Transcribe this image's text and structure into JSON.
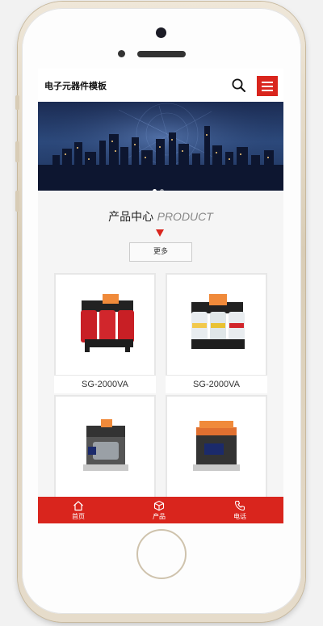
{
  "header": {
    "site_title": "电子元器件模板"
  },
  "section": {
    "title_cn": "产品中心",
    "title_en": "PRODUCT",
    "more_label": "更多"
  },
  "products": [
    {
      "name": "SG-2000VA"
    },
    {
      "name": "SG-2000VA"
    },
    {
      "name": ""
    },
    {
      "name": ""
    }
  ],
  "tabbar": {
    "home_label": "首页",
    "products_label": "产品",
    "phone_label": "电话"
  },
  "colors": {
    "accent": "#d9251d"
  }
}
